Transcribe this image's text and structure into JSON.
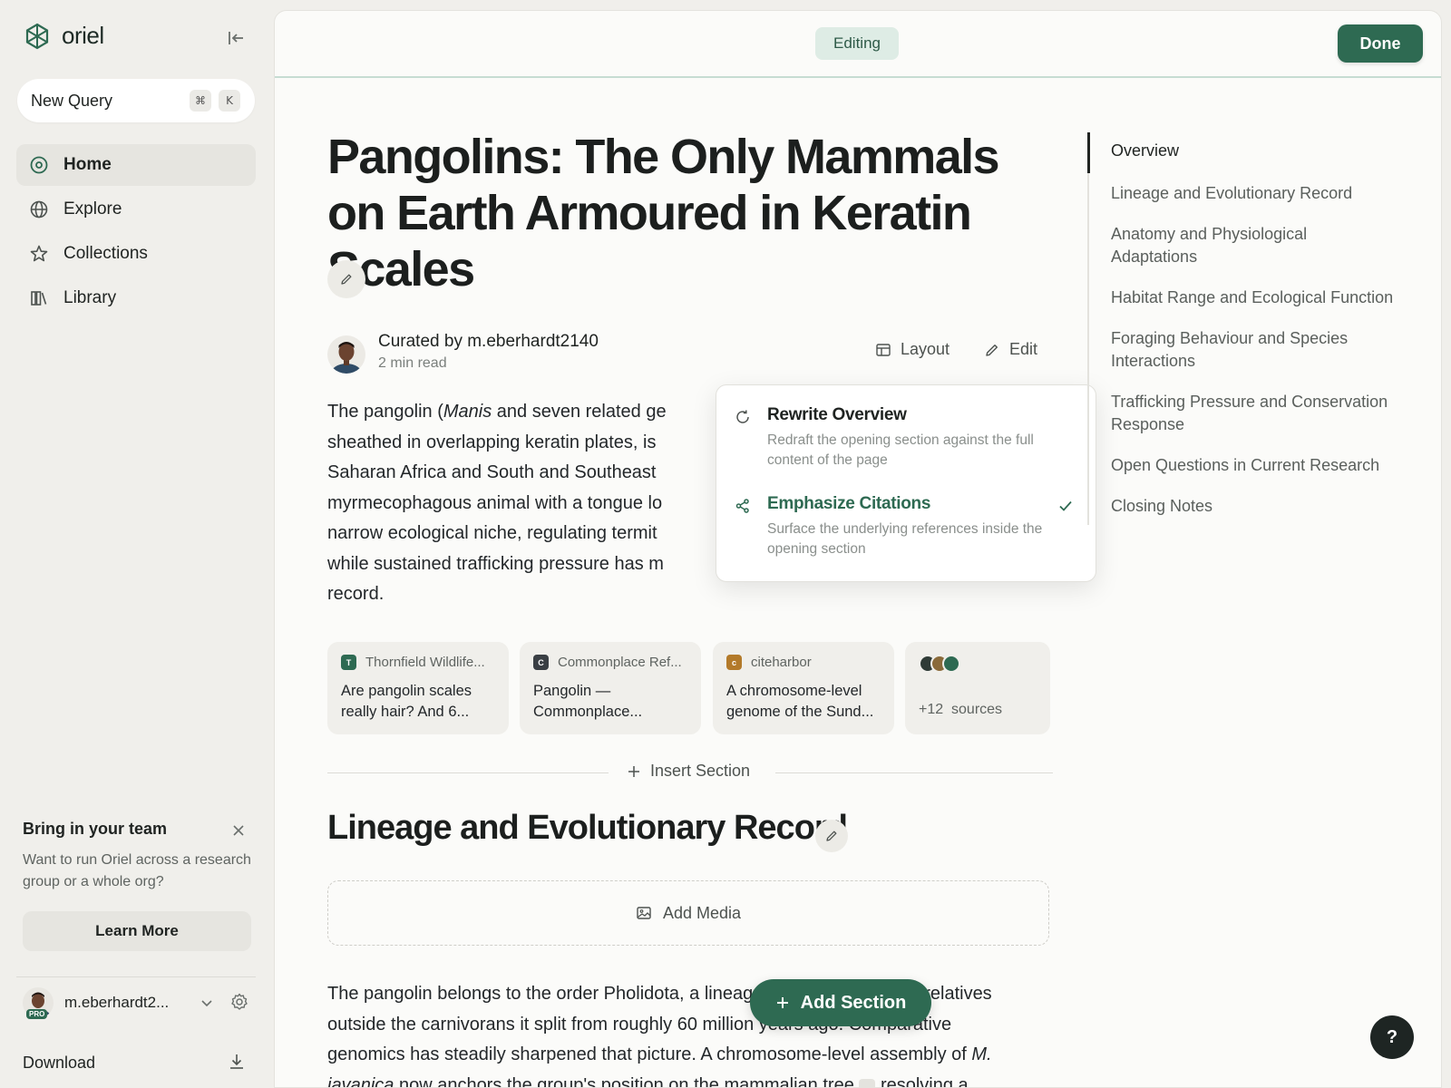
{
  "app": {
    "name": "oriel"
  },
  "sidebar": {
    "new_query": {
      "label": "New Query",
      "shortcut_mod": "⌘",
      "shortcut_key": "K"
    },
    "nav": [
      {
        "label": "Home",
        "icon": "compass-icon",
        "active": true
      },
      {
        "label": "Explore",
        "icon": "globe-icon"
      },
      {
        "label": "Collections",
        "icon": "star-icon"
      },
      {
        "label": "Library",
        "icon": "books-icon"
      }
    ],
    "promo": {
      "title": "Bring in your team",
      "text": "Want to run Oriel across a research group or a whole org?",
      "button": "Learn More"
    },
    "user": {
      "name": "m.eberhardt2...",
      "badge": "PRO"
    },
    "download": "Download"
  },
  "toolbar": {
    "status": "Editing",
    "done": "Done"
  },
  "article": {
    "title": "Pangolins: The Only Mammals on Earth Armoured in Keratin Scales",
    "author": "Curated by m.eberhardt2140",
    "read_time": "2 min read",
    "layout_label": "Layout",
    "edit_label": "Edit",
    "overview": {
      "line1_a": "The pangolin (",
      "line1_em": "Manis",
      "line1_b": " and seven related ge",
      "line2": "sheathed in overlapping keratin plates, is",
      "line3": "Saharan Africa and South and Southeast ",
      "line4": "myrmecophagous animal with a tongue lo",
      "line5": "narrow ecological niche, regulating termit",
      "line6": "while sustained trafficking pressure has m",
      "line7": "record."
    },
    "sources": [
      {
        "site": "Thornfield Wildlife...",
        "title": "Are pangolin scales really hair? And 6...",
        "fav": "T",
        "color": "#2e6a52"
      },
      {
        "site": "Commonplace Ref...",
        "title": "Pangolin — Commonplace...",
        "fav": "C",
        "color": "#3a3f44"
      },
      {
        "site": "citeharbor",
        "title": "A chromosome-level genome of the Sund...",
        "fav": "c",
        "color": "#b37a2a"
      }
    ],
    "more_sources": {
      "count": "+12",
      "label": "sources",
      "colors": [
        "#2f3b36",
        "#8a6a3a",
        "#2e6a52"
      ]
    },
    "insert_section": "Insert Section",
    "section_title": "Lineage and Evolutionary Record",
    "add_media": "Add Media",
    "section_text": {
      "line1": "The pangolin belongs to the order Pholidota, a lineage with no close living relatives",
      "line2": "outside the carnivorans it split from roughly 60 million years ago. Comparative",
      "line3_a": "genomics has steadily sharpened that picture. A chromosome-level assembly of ",
      "line3_em": "M.",
      "line4_em": "javanica",
      "line4_b": " now anchors the group's position on the mammalian tree",
      "line4_c": " resolving a"
    }
  },
  "popover": {
    "items": [
      {
        "title": "Rewrite Overview",
        "desc": "Redraft the opening section against the full content of the page",
        "icon": "refresh-icon"
      },
      {
        "title": "Emphasize Citations",
        "desc": "Surface the underlying references inside the opening section",
        "icon": "share-icon",
        "checked": true
      }
    ]
  },
  "toc": [
    "Overview",
    "Lineage and Evolutionary Record",
    "Anatomy and Physiological Adaptations",
    "Habitat Range and Ecological Function",
    "Foraging Behaviour and Species Interactions",
    "Trafficking Pressure and Conservation Response",
    "Open Questions in Current Research",
    "Closing Notes"
  ],
  "floating": {
    "add_section": "Add Section",
    "help": "?"
  },
  "colors": {
    "accent": "#2e6a52",
    "background": "#f0efeb",
    "panel": "#fbfbf9"
  }
}
